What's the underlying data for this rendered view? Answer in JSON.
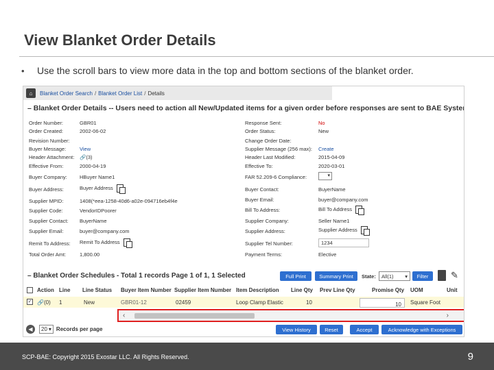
{
  "slide": {
    "title": "View Blanket Order Details",
    "bullet": "Use the scroll bars to view more data in the top and bottom sections of the blanket order.",
    "footer": "SCP-BAE: Copyright 2015 Exostar LLC. All Rights Reserved.",
    "page_number": "9"
  },
  "breadcrumb": {
    "search": "Blanket Order Search",
    "list": "Blanket Order List",
    "current": "Details",
    "sep": "/"
  },
  "details": {
    "header": "– Blanket Order Details -- Users need to action all New/Updated items for a given order before responses are sent to BAE Systems.",
    "left": [
      {
        "label": "Order Number:",
        "value": "GBR01"
      },
      {
        "label": "Order Created:",
        "value": "2002-06-02"
      },
      {
        "label": "Revision Number:",
        "value": ""
      },
      {
        "label": "Buyer Message:",
        "value": "View"
      },
      {
        "label": "Header Attachment:",
        "value": "(3)"
      },
      {
        "label": "Effective From:",
        "value": "2000-04-19"
      },
      {
        "label": "Buyer Company:",
        "value": "HBuyer Name1"
      },
      {
        "label": "Buyer Address:",
        "value": "Buyer Address"
      },
      {
        "label": "Supplier MPID:",
        "value": "1408(*eea-1258-40d6-a02e-094716eb4f4e"
      },
      {
        "label": "Supplier Code:",
        "value": "VendorIDPoorer"
      },
      {
        "label": "Supplier Contact:",
        "value": "BuyerName"
      },
      {
        "label": "Supplier Email:",
        "value": "buyer@company.com"
      },
      {
        "label": "Remit To Address:",
        "value": "Remit To Address"
      },
      {
        "label": "Total Order Amt:",
        "value": "1,800.00"
      }
    ],
    "right": [
      {
        "label": "Response Sent:",
        "value": "No"
      },
      {
        "label": "Order Status:",
        "value": "New"
      },
      {
        "label": "Change Order Date:",
        "value": ""
      },
      {
        "label": "Supplier Message (256 max):",
        "value": "Create"
      },
      {
        "label": "Header Last Modified:",
        "value": "2015-04-09"
      },
      {
        "label": "Effective To:",
        "value": "2020-03-01"
      },
      {
        "label": "FAR 52.209-6 Compliance:",
        "value": ""
      },
      {
        "label": "Buyer Contact:",
        "value": "BuyerName"
      },
      {
        "label": "Buyer Email:",
        "value": "buyer@company.com"
      },
      {
        "label": "Bill To Address:",
        "value": "Bill To Address"
      },
      {
        "label": "Supplier Company:",
        "value": "Seller Name1"
      },
      {
        "label": "Supplier Address:",
        "value": "Supplier Address"
      },
      {
        "label": "Supplier Tel Number:",
        "value": "1234"
      },
      {
        "label": "Payment Terms:",
        "value": "Elective"
      }
    ]
  },
  "schedules": {
    "header": "– Blanket Order Schedules - Total 1 records Page 1 of 1, 1 Selected",
    "full_print": "Full Print",
    "summary_print": "Summary Print",
    "state_label": "State:",
    "state_value": "All(1)",
    "filter": "Filter",
    "columns": [
      "Action",
      "Line",
      "Line Status",
      "Buyer Item Number",
      "Supplier Item Number",
      "Item Description",
      "Line Qty",
      "Prev Line Qty",
      "Promise Qty",
      "UOM",
      "Unit"
    ],
    "row": {
      "attachments": "(0)",
      "line": "1",
      "status": "New",
      "buyer_item": "GBR01-12",
      "supplier_item": "02459",
      "description": "Loop Clamp Elastic",
      "line_qty": "10",
      "promise_qty": "10",
      "uom": "Square Foot"
    }
  },
  "pager": {
    "per_page_value": "20",
    "per_page_label": "Records per page"
  },
  "actions": {
    "view_history": "View History",
    "reset": "Reset",
    "accept": "Accept",
    "acknowledge": "Acknowledge with Exceptions"
  },
  "colors": {
    "button_blue": "#2e6fd0",
    "highlight_red": "#e02020",
    "link_blue": "#1a4fa0",
    "row_yellow": "#fdf9d8"
  }
}
